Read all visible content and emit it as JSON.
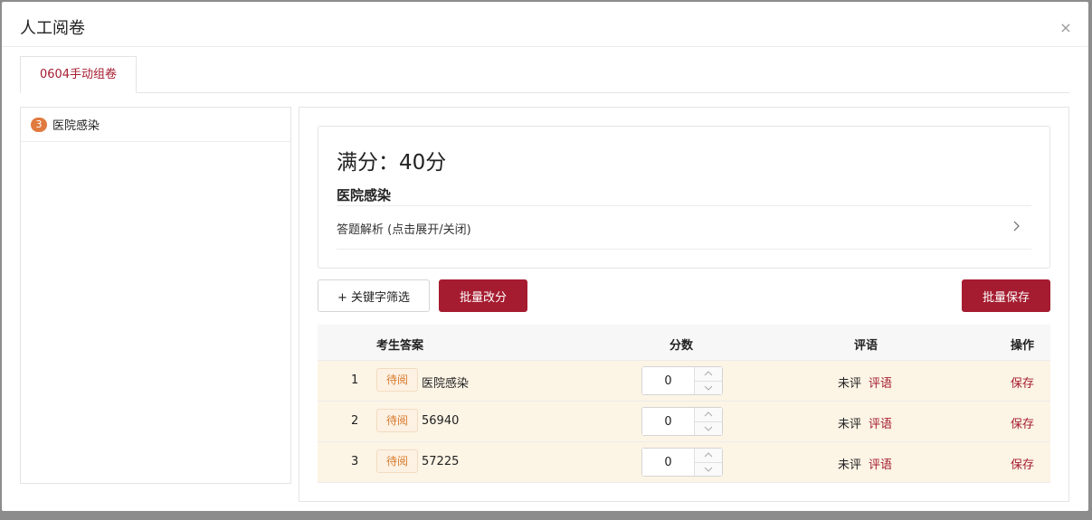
{
  "background": {
    "row_text": ""
  },
  "modal": {
    "title": "人工阅卷",
    "close_label": "×"
  },
  "tabs": [
    {
      "label": "0604手动组卷"
    }
  ],
  "left_panel": {
    "items": [
      {
        "badge": "3",
        "label": "医院感染"
      }
    ]
  },
  "info": {
    "full_score": "满分：40分",
    "question_title": "医院感染",
    "analysis_label": "答题解析 (点击展开/关闭)",
    "chevron": "›"
  },
  "toolbar": {
    "keyword_filter_label": "+ 关键字筛选",
    "batch_score_label": "批量改分",
    "batch_save_label": "批量保存"
  },
  "table": {
    "headers": {
      "answer": "考生答案",
      "score": "分数",
      "comment": "评语",
      "action": "操作"
    },
    "rows": [
      {
        "index": "1",
        "status": "待阅",
        "answer": "医院感染",
        "score": "0",
        "comment_status": "未评",
        "comment_link": "评语",
        "action": "保存"
      },
      {
        "index": "2",
        "status": "待阅",
        "answer": "56940",
        "score": "0",
        "comment_status": "未评",
        "comment_link": "评语",
        "action": "保存"
      },
      {
        "index": "3",
        "status": "待阅",
        "answer": "57225",
        "score": "0",
        "comment_status": "未评",
        "comment_link": "评语",
        "action": "保存"
      }
    ]
  },
  "colors": {
    "accent": "#a51c30",
    "badge": "#e07a3f",
    "row_bg": "#fcf4e5",
    "status_text": "#d67a2c"
  },
  "icons": {
    "close": "close-icon",
    "chevron": "chevron-right-icon",
    "step_up": "caret-up-icon",
    "step_down": "caret-down-icon"
  }
}
